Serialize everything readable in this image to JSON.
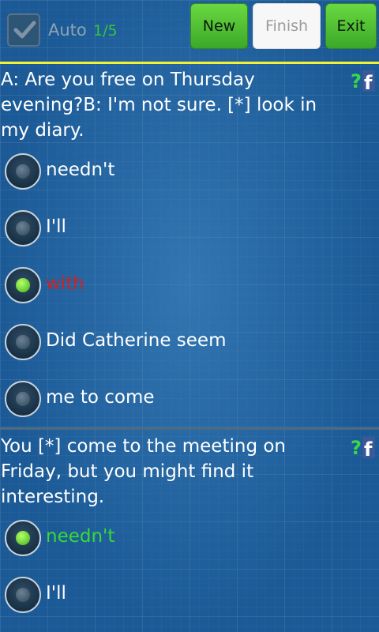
{
  "header": {
    "auto_label": "Auto",
    "auto_count": "1/5",
    "auto_checked": true,
    "buttons": {
      "new": "New",
      "finish": "Finish",
      "exit": "Exit"
    }
  },
  "questions": [
    {
      "text": "A: Are you free on Thursday evening?B: I'm not sure. [*] look in my diary.",
      "badge_icon": "help-facebook-icon",
      "options": [
        {
          "label": "needn't",
          "selected": false,
          "state": "normal"
        },
        {
          "label": "I'll",
          "selected": false,
          "state": "normal"
        },
        {
          "label": "with",
          "selected": true,
          "state": "wrong"
        },
        {
          "label": "Did Catherine seem",
          "selected": false,
          "state": "normal"
        },
        {
          "label": "me to come",
          "selected": false,
          "state": "normal"
        }
      ]
    },
    {
      "text": "You [*] come to the meeting on Friday, but you might find it interesting.",
      "badge_icon": "help-facebook-icon",
      "options": [
        {
          "label": "needn't",
          "selected": true,
          "state": "correct"
        },
        {
          "label": "I'll",
          "selected": false,
          "state": "normal"
        }
      ]
    }
  ],
  "colors": {
    "background": "#1b5a96",
    "accent_green": "#39d936",
    "wrong_red": "#d42020",
    "separator_yellow": "#f3f038"
  }
}
